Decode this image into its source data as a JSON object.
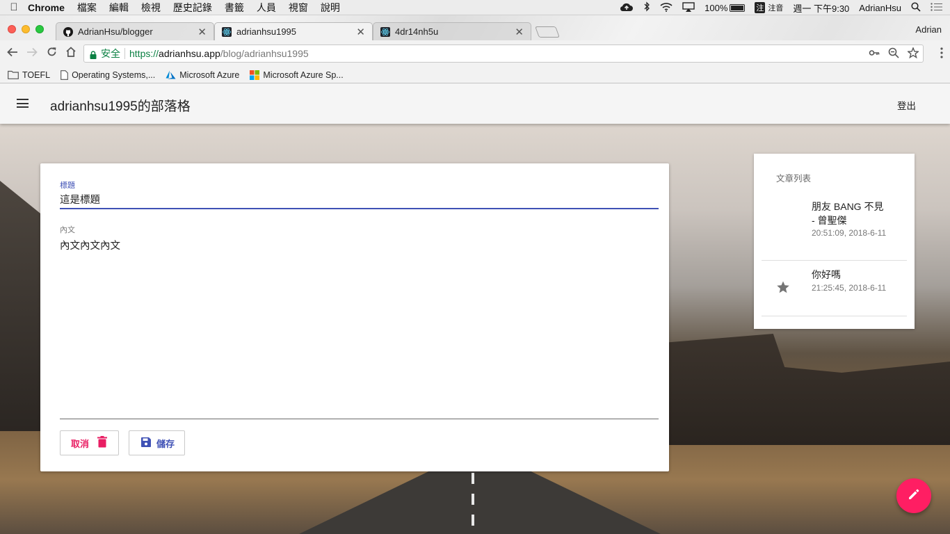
{
  "menubar": {
    "app": "Chrome",
    "items": [
      "檔案",
      "編輯",
      "檢視",
      "歷史記錄",
      "書籤",
      "人員",
      "視窗",
      "說明"
    ],
    "battery": "100%",
    "ime": "注音",
    "ime_badge": "注",
    "clock": "週一 下午9:30",
    "user": "AdrianHsu"
  },
  "tabs": [
    {
      "title": "AdrianHsu/blogger",
      "icon": "github-icon"
    },
    {
      "title": "adrianhsu1995",
      "icon": "react-icon"
    },
    {
      "title": "4dr14nh5u",
      "icon": "react-icon"
    }
  ],
  "profile": "Adrian",
  "omnibox": {
    "secure_label": "安全",
    "scheme": "https://",
    "host": "adrianhsu.app",
    "path": "/blog/adrianhsu1995"
  },
  "bookmarks": [
    {
      "label": "TOEFL",
      "icon": "folder-icon"
    },
    {
      "label": "Operating Systems,...",
      "icon": "page-icon"
    },
    {
      "label": "Microsoft Azure",
      "icon": "azure-icon"
    },
    {
      "label": "Microsoft Azure Sp...",
      "icon": "microsoft-icon"
    }
  ],
  "appbar": {
    "title": "adrianhsu1995的部落格",
    "logout": "登出"
  },
  "editor": {
    "title_label": "標題",
    "title_value": "這是標題",
    "body_label": "內文",
    "body_value": "內文內文內文",
    "cancel_label": "取消",
    "save_label": "儲存"
  },
  "sidebar": {
    "title": "文章列表",
    "posts": [
      {
        "title": "朋友 BANG 不見 - 曾聖傑",
        "date": "20:51:09, 2018-6-11",
        "starred": false
      },
      {
        "title": "你好嗎",
        "date": "21:25:45, 2018-6-11",
        "starred": true
      }
    ]
  },
  "colors": {
    "primary": "#3f51b5",
    "accent": "#ff1e63",
    "secure_green": "#0b8043"
  }
}
